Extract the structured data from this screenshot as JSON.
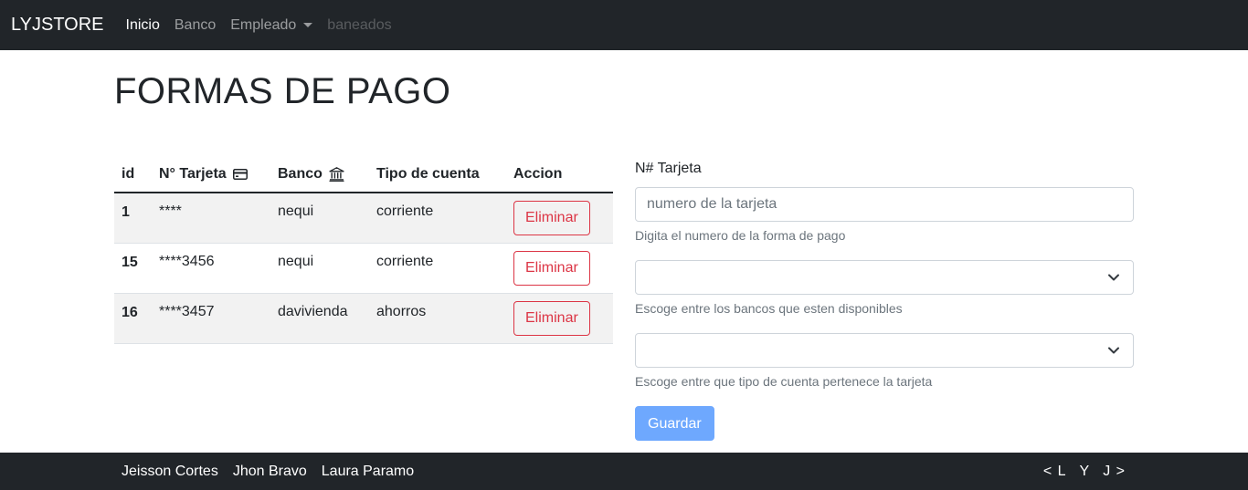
{
  "navbar": {
    "brand": "LYJSTORE",
    "links": [
      {
        "label": "Inicio",
        "state": "active"
      },
      {
        "label": "Banco",
        "state": "normal"
      },
      {
        "label": "Empleado",
        "state": "dropdown"
      },
      {
        "label": "baneados",
        "state": "disabled"
      }
    ]
  },
  "page": {
    "title": "FORMAS DE PAGO"
  },
  "table": {
    "headers": {
      "id": "id",
      "card": "N° Tarjeta",
      "bank": "Banco",
      "type": "Tipo de cuenta",
      "action": "Accion"
    },
    "header_icons": {
      "card": "credit-card-icon",
      "bank": "bank-icon"
    },
    "rows": [
      {
        "id": "1",
        "card": "****",
        "bank": "nequi",
        "type": "corriente",
        "action": "Eliminar"
      },
      {
        "id": "15",
        "card": "****3456",
        "bank": "nequi",
        "type": "corriente",
        "action": "Eliminar"
      },
      {
        "id": "16",
        "card": "****3457",
        "bank": "davivienda",
        "type": "ahorros",
        "action": "Eliminar"
      }
    ]
  },
  "form": {
    "card_label": "N# Tarjeta",
    "card_placeholder": "numero de la tarjeta",
    "card_help": "Digita el numero de la forma de pago",
    "bank_help": "Escoge entre los bancos que esten disponibles",
    "type_help": "Escoge entre que tipo de cuenta pertenece la tarjeta",
    "save_label": "Guardar"
  },
  "footer": {
    "names": [
      "Jeisson Cortes",
      "Jhon Bravo",
      "Laura Paramo"
    ],
    "nav": [
      "< L",
      "Y",
      "J >"
    ]
  },
  "colors": {
    "navbar_bg": "#212529",
    "danger": "#dc3545",
    "primary_disabled": "#6ea8fe",
    "stripe": "#f2f2f2"
  }
}
